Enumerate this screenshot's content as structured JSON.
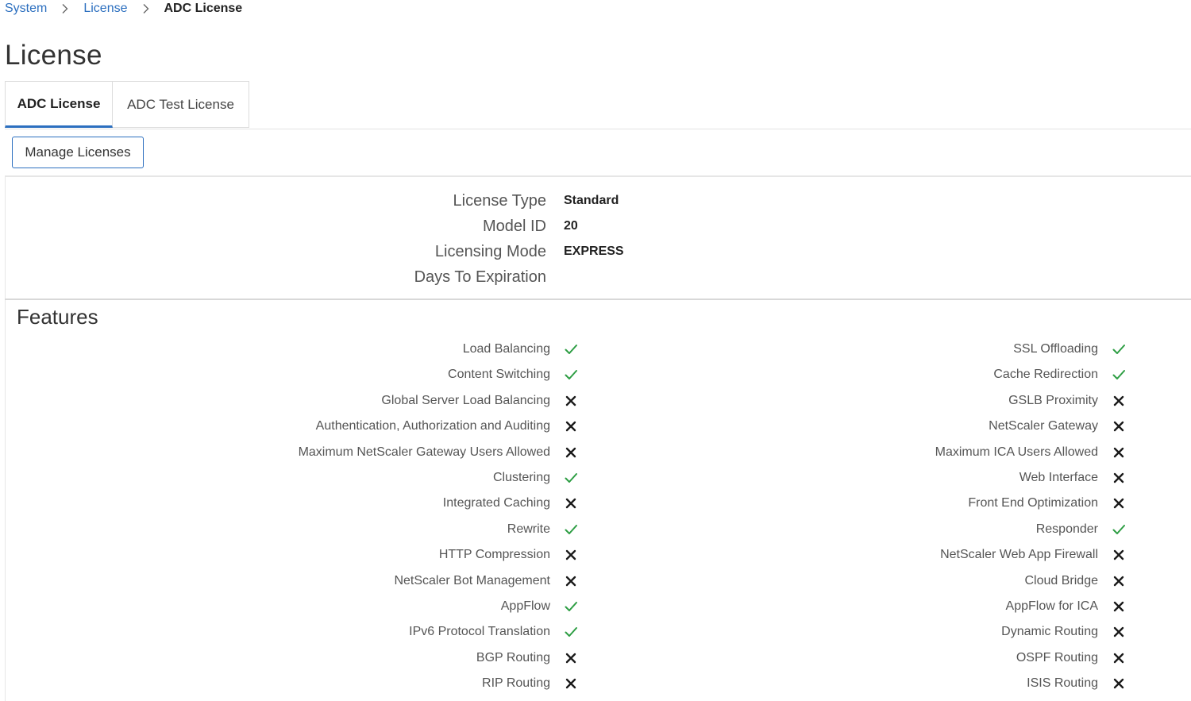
{
  "breadcrumb": {
    "items": [
      "System",
      "License"
    ],
    "current": "ADC License"
  },
  "page": {
    "title": "License"
  },
  "tabs": [
    {
      "label": "ADC License",
      "active": true
    },
    {
      "label": "ADC Test License",
      "active": false
    }
  ],
  "toolbar": {
    "manage_label": "Manage Licenses"
  },
  "details": [
    {
      "label": "License Type",
      "value": "Standard"
    },
    {
      "label": "Model ID",
      "value": "20"
    },
    {
      "label": "Licensing Mode",
      "value": "EXPRESS"
    },
    {
      "label": "Days To Expiration",
      "value": ""
    }
  ],
  "features": {
    "title": "Features",
    "left": [
      {
        "label": "Load Balancing",
        "enabled": true
      },
      {
        "label": "Content Switching",
        "enabled": true
      },
      {
        "label": "Global Server Load Balancing",
        "enabled": false
      },
      {
        "label": "Authentication, Authorization and Auditing",
        "enabled": false
      },
      {
        "label": "Maximum NetScaler Gateway Users Allowed",
        "enabled": false
      },
      {
        "label": "Clustering",
        "enabled": true
      },
      {
        "label": "Integrated Caching",
        "enabled": false
      },
      {
        "label": "Rewrite",
        "enabled": true
      },
      {
        "label": "HTTP Compression",
        "enabled": false
      },
      {
        "label": "NetScaler Bot Management",
        "enabled": false
      },
      {
        "label": "AppFlow",
        "enabled": true
      },
      {
        "label": "IPv6 Protocol Translation",
        "enabled": true
      },
      {
        "label": "BGP Routing",
        "enabled": false
      },
      {
        "label": "RIP Routing",
        "enabled": false
      }
    ],
    "right": [
      {
        "label": "SSL Offloading",
        "enabled": true
      },
      {
        "label": "Cache Redirection",
        "enabled": true
      },
      {
        "label": "GSLB Proximity",
        "enabled": false
      },
      {
        "label": "NetScaler Gateway",
        "enabled": false
      },
      {
        "label": "Maximum ICA Users Allowed",
        "enabled": false
      },
      {
        "label": "Web Interface",
        "enabled": false
      },
      {
        "label": "Front End Optimization",
        "enabled": false
      },
      {
        "label": "Responder",
        "enabled": true
      },
      {
        "label": "NetScaler Web App Firewall",
        "enabled": false
      },
      {
        "label": "Cloud Bridge",
        "enabled": false
      },
      {
        "label": "AppFlow for ICA",
        "enabled": false
      },
      {
        "label": "Dynamic Routing",
        "enabled": false
      },
      {
        "label": "OSPF Routing",
        "enabled": false
      },
      {
        "label": "ISIS Routing",
        "enabled": false
      }
    ]
  },
  "icons": {
    "enabled": "checkmark-icon",
    "disabled": "cross-icon",
    "separator": "chevron-right-icon"
  },
  "colors": {
    "link": "#2c6fbf",
    "enabled": "#2e9e44",
    "disabled": "#1a1a1a"
  }
}
